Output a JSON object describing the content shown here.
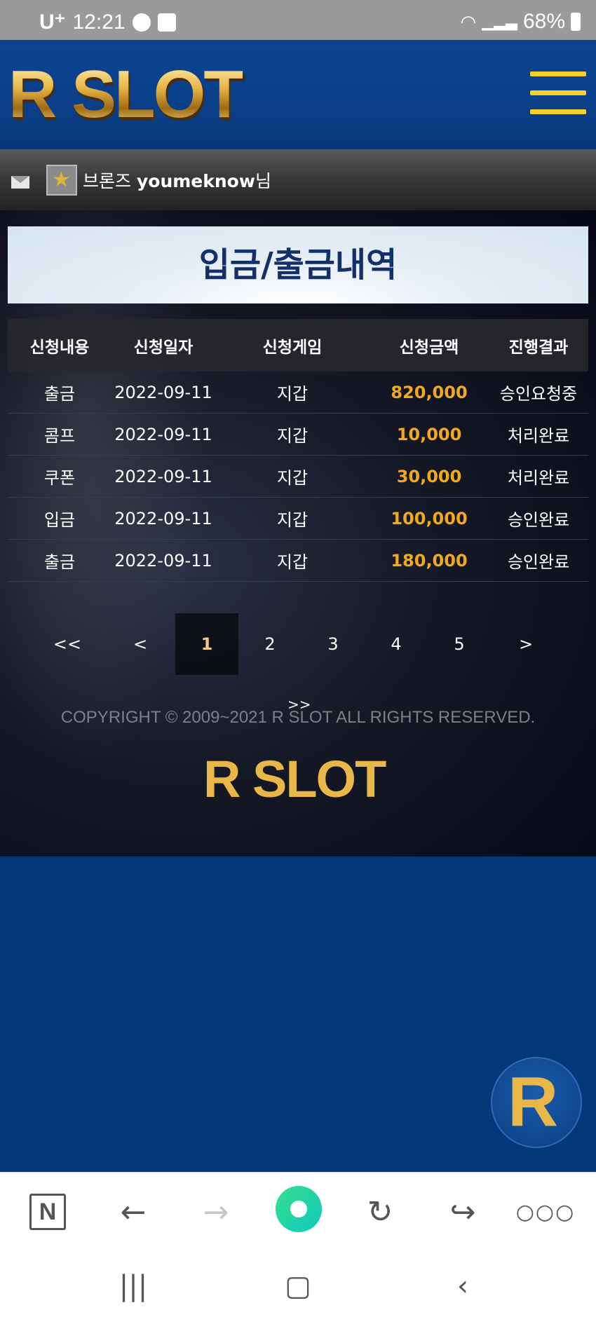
{
  "status_bar": {
    "carrier": "U⁺",
    "time": "12:21",
    "battery": "68%"
  },
  "header": {
    "logo": "R SLOT",
    "menu_icon": "hamburger-icon"
  },
  "user_bar": {
    "rank": "브론즈",
    "username": "youmeknow",
    "suffix": "님"
  },
  "page": {
    "title": "입금/출금내역"
  },
  "table": {
    "columns": [
      "신청내용",
      "신청일자",
      "신청게임",
      "신청금액",
      "진행결과"
    ],
    "rows": [
      {
        "type": "출금",
        "date": "2022-09-11",
        "game": "지갑",
        "amount": "820,000",
        "result": "승인요청중"
      },
      {
        "type": "콤프",
        "date": "2022-09-11",
        "game": "지갑",
        "amount": "10,000",
        "result": "처리완료"
      },
      {
        "type": "쿠폰",
        "date": "2022-09-11",
        "game": "지갑",
        "amount": "30,000",
        "result": "처리완료"
      },
      {
        "type": "입금",
        "date": "2022-09-11",
        "game": "지갑",
        "amount": "100,000",
        "result": "승인완료"
      },
      {
        "type": "출금",
        "date": "2022-09-11",
        "game": "지갑",
        "amount": "180,000",
        "result": "승인완료"
      }
    ]
  },
  "pagination": {
    "first": "<<",
    "prev": "<",
    "pages": [
      "1",
      "2",
      "3",
      "4",
      "5"
    ],
    "active": "1",
    "next": ">",
    "last": ">>"
  },
  "footer": {
    "copyright": "COPYRIGHT © 2009~2021 R SLOT ALL RIGHTS RESERVED.",
    "logo": "R SLOT",
    "fab_label": "R"
  },
  "colors": {
    "brand_blue": "#023778",
    "gold": "#e9b648",
    "amount": "#f4a91b",
    "title_text": "#13306a"
  }
}
